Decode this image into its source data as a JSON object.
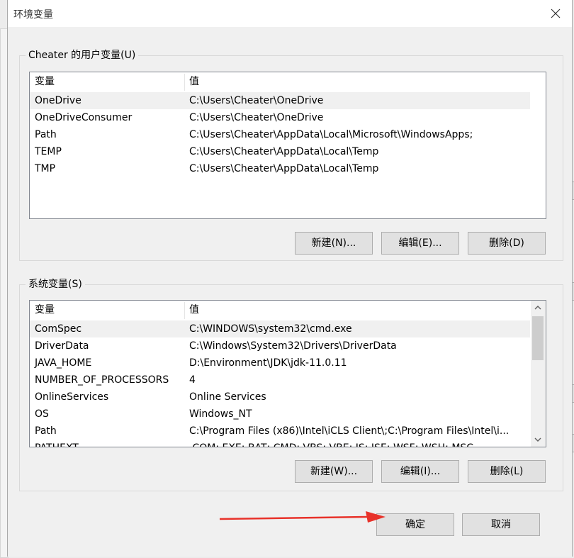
{
  "dialog": {
    "title": "环境变量",
    "close_icon": "close-icon"
  },
  "user_vars": {
    "legend": "Cheater 的用户变量(U)",
    "columns": [
      "变量",
      "值"
    ],
    "rows": [
      {
        "name": "OneDrive",
        "value": "C:\\Users\\Cheater\\OneDrive"
      },
      {
        "name": "OneDriveConsumer",
        "value": "C:\\Users\\Cheater\\OneDrive"
      },
      {
        "name": "Path",
        "value": "C:\\Users\\Cheater\\AppData\\Local\\Microsoft\\WindowsApps;"
      },
      {
        "name": "TEMP",
        "value": "C:\\Users\\Cheater\\AppData\\Local\\Temp"
      },
      {
        "name": "TMP",
        "value": "C:\\Users\\Cheater\\AppData\\Local\\Temp"
      }
    ],
    "buttons": {
      "new": "新建(N)...",
      "edit": "编辑(E)...",
      "delete": "删除(D)"
    }
  },
  "system_vars": {
    "legend": "系统变量(S)",
    "columns": [
      "变量",
      "值"
    ],
    "rows": [
      {
        "name": "ComSpec",
        "value": "C:\\WINDOWS\\system32\\cmd.exe"
      },
      {
        "name": "DriverData",
        "value": "C:\\Windows\\System32\\Drivers\\DriverData"
      },
      {
        "name": "JAVA_HOME",
        "value": "D:\\Environment\\JDK\\jdk-11.0.11"
      },
      {
        "name": "NUMBER_OF_PROCESSORS",
        "value": "4"
      },
      {
        "name": "OnlineServices",
        "value": "Online Services"
      },
      {
        "name": "OS",
        "value": "Windows_NT"
      },
      {
        "name": "Path",
        "value": "C:\\Program Files (x86)\\Intel\\iCLS Client\\;C:\\Program Files\\Intel\\i..."
      },
      {
        "name": "PATHEXT",
        "value": ".COM;.EXE;.BAT;.CMD;.VBS;.VBE;.JS;.JSE;.WSF;.WSH;.MSC"
      }
    ],
    "buttons": {
      "new": "新建(W)...",
      "edit": "编辑(I)...",
      "delete": "删除(L)"
    }
  },
  "footer": {
    "ok": "确定",
    "cancel": "取消"
  },
  "annotation": {
    "arrow_color": "#e8322a"
  }
}
